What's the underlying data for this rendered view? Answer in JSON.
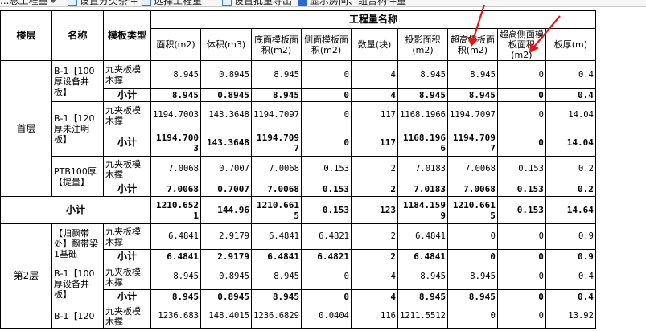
{
  "toolbar": {
    "item1": "...总工程量",
    "item2": "设置分类条件",
    "item3": "选择工程量",
    "item4": "设置批量导出",
    "item5": "显示房间、组合构件量"
  },
  "header": {
    "floor": "楼层",
    "name": "名称",
    "type": "模板类型",
    "group": "工程量名称",
    "cols": [
      "面积(m2)",
      "体积(m3)",
      "底面模板面积(m2)",
      "侧面模板面积(m2)",
      "数量(块)",
      "投影面积(m2)",
      "超高模板面积(m2)",
      "超高侧面模板面积(m2)",
      "板厚(m)"
    ]
  },
  "table": {
    "floor1": "首层",
    "floor2": "第2层",
    "panel": "九夹板模木撑",
    "subtotal": "小计",
    "items": [
      {
        "name": "B-1【100厚设备井板】",
        "detail": [
          "8.945",
          "0.8945",
          "8.945",
          "0",
          "4",
          "8.945",
          "8.945",
          "0",
          "0.4"
        ],
        "total": [
          "8.945",
          "0.8945",
          "8.945",
          "0",
          "4",
          "8.945",
          "8.945",
          "0",
          "0.4"
        ]
      },
      {
        "name": "B-1【120厚未注明板】",
        "detail": [
          "1194.7003",
          "143.3648",
          "1194.7097",
          "0",
          "117",
          "1168.1966",
          "1194.7097",
          "0",
          "14.04"
        ],
        "total": [
          "1194.7003",
          "143.3648",
          "1194.7097",
          "0",
          "117",
          "1168.1966",
          "1194.7097",
          "0",
          "14.04"
        ]
      },
      {
        "name": "PTB100厚【提量】",
        "detail": [
          "7.0068",
          "0.7007",
          "7.0068",
          "0.153",
          "2",
          "7.0183",
          "7.0068",
          "0.153",
          "0.2"
        ],
        "total": [
          "7.0068",
          "0.7007",
          "7.0068",
          "0.153",
          "2",
          "7.0183",
          "7.0068",
          "0.153",
          "0.2"
        ]
      },
      {
        "name": "【归飘带处】飘带梁1基础",
        "detail": [
          "6.4841",
          "2.9179",
          "6.4841",
          "6.4821",
          "2",
          "6.4841",
          "0",
          "0",
          "0.9"
        ],
        "total": [
          "6.4841",
          "2.9179",
          "6.4841",
          "6.4821",
          "2",
          "6.4841",
          "0",
          "0",
          "0.9"
        ]
      },
      {
        "name": "B-1【100厚设备井板】",
        "detail": [
          "8.945",
          "0.8945",
          "8.945",
          "0",
          "4",
          "8.945",
          "8.945",
          "0",
          "0.4"
        ],
        "total": [
          "8.945",
          "0.8945",
          "8.945",
          "0",
          "4",
          "8.945",
          "8.945",
          "0",
          "0.4"
        ]
      },
      {
        "name": "B-1【120",
        "detail": [
          "1236.683",
          "148.4015",
          "1236.6829",
          "0.0404",
          "116",
          "1211.5512",
          "0",
          "0",
          "13.92"
        ]
      }
    ],
    "floorSubtotal": [
      "1210.6521",
      "144.96",
      "1210.6615",
      "0.153",
      "123",
      "1184.1599",
      "1210.6615",
      "0.153",
      "14.64"
    ]
  }
}
